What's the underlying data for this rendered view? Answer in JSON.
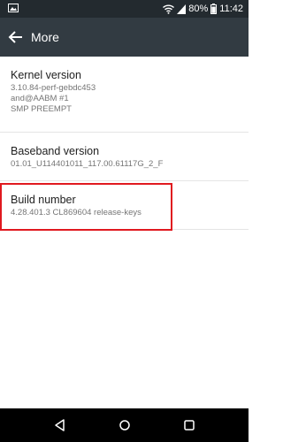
{
  "status_bar": {
    "battery_percent": "80%",
    "time": "11:42",
    "left_icon": "image-icon",
    "right_icons": [
      "wifi-icon",
      "cellular-signal-icon",
      "battery-icon"
    ]
  },
  "app_bar": {
    "title": "More",
    "back_icon": "back-arrow-icon"
  },
  "settings": {
    "kernel": {
      "title": "Kernel version",
      "value": "3.10.84-perf-gebdc453\nand@AABM #1\nSMP PREEMPT"
    },
    "baseband": {
      "title": "Baseband version",
      "value": "01.01_U114401011_117.00.61117G_2_F"
    },
    "build": {
      "title": "Build number",
      "value": "4.28.401.3 CL869604 release-keys"
    }
  },
  "highlight": {
    "color": "#e0191f",
    "target": "build"
  },
  "nav_bar": {
    "buttons": [
      "nav-back-icon",
      "nav-home-icon",
      "nav-recents-icon"
    ]
  },
  "colors": {
    "status_bar": "#232a2f",
    "app_bar": "#323b42",
    "nav_bar": "#000000",
    "title_text": "#212121",
    "secondary_text": "#757575"
  }
}
